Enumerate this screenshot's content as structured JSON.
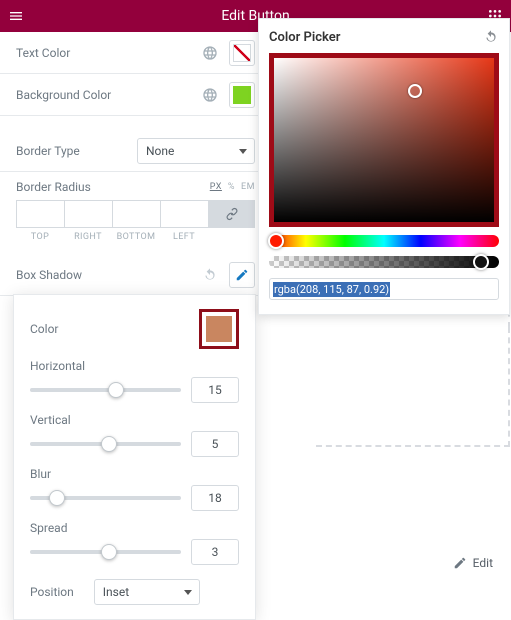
{
  "topbar": {
    "title": "Edit Button"
  },
  "styleRows": {
    "textColor": {
      "label": "Text Color",
      "swatchColor": "none"
    },
    "backgroundColor": {
      "label": "Background Color",
      "swatchColor": "#7ed321"
    },
    "borderType": {
      "label": "Border Type",
      "value": "None"
    },
    "borderRadius": {
      "label": "Border Radius",
      "units": [
        "PX",
        "%",
        "EM"
      ],
      "activeUnit": "PX",
      "sides": [
        "TOP",
        "RIGHT",
        "BOTTOM",
        "LEFT"
      ]
    },
    "boxShadow": {
      "label": "Box Shadow"
    }
  },
  "boxShadow": {
    "colorLabel": "Color",
    "colorValue": "#c98660",
    "horizontal": {
      "label": "Horizontal",
      "value": "15",
      "pct": 57
    },
    "vertical": {
      "label": "Vertical",
      "value": "5",
      "pct": 52
    },
    "blur": {
      "label": "Blur",
      "value": "18",
      "pct": 18
    },
    "spread": {
      "label": "Spread",
      "value": "3",
      "pct": 52
    },
    "position": {
      "label": "Position",
      "value": "Inset"
    }
  },
  "colorPicker": {
    "title": "Color Picker",
    "input": "rgba(208, 115, 87, 0.92)",
    "cursor": {
      "xPct": 61,
      "yPct": 16
    },
    "hueKnobPct": 3,
    "alphaKnobPct": 92
  },
  "edit": {
    "label": "Edit"
  }
}
